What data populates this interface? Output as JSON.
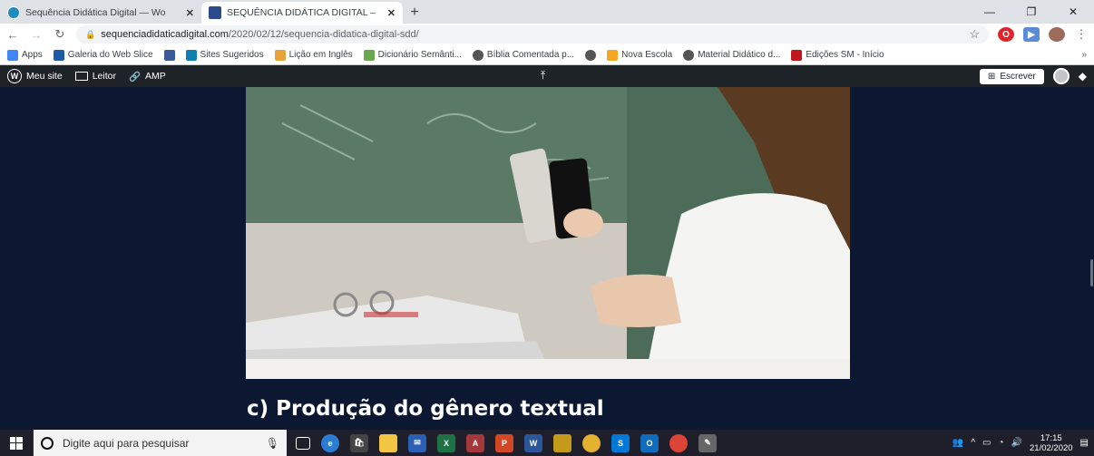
{
  "browser": {
    "tabs": [
      {
        "title": "Sequência Didática Digital — Wo",
        "icon": "wordpress-icon",
        "color": "#1e8cbe",
        "active": false
      },
      {
        "title": "SEQUÊNCIA DIDÁTICA DIGITAL –",
        "icon": "site-favicon",
        "color": "#2b4a8b",
        "active": true
      }
    ],
    "new_tab": "+",
    "window_controls": {
      "minimize": "—",
      "restore": "❐",
      "close": "✕"
    },
    "url_host": "sequenciadidaticadigital.com",
    "url_path": "/2020/02/12/sequencia-didatica-digital-sdd/",
    "bookmarks": [
      {
        "label": "Apps",
        "icon": "apps-grid-icon",
        "color": "#4285f4"
      },
      {
        "label": "Galeria do Web Slice",
        "icon": "web-slice-icon",
        "color": "#1e5aa8"
      },
      {
        "label": "",
        "icon": "facebook-icon",
        "color": "#3b5998"
      },
      {
        "label": "Sites Sugeridos",
        "icon": "bing-icon",
        "color": "#0f7fb2"
      },
      {
        "label": "Lição em Inglês",
        "icon": "lesson-icon",
        "color": "#e8a23a"
      },
      {
        "label": "Dicionário Semânti...",
        "icon": "dictionary-icon",
        "color": "#6aa84f"
      },
      {
        "label": "Bíblia Comentada p...",
        "icon": "globe-icon",
        "color": "#555555"
      },
      {
        "label": "",
        "icon": "globe-icon",
        "color": "#555555"
      },
      {
        "label": "Nova Escola",
        "icon": "nova-escola-icon",
        "color": "#f5a623"
      },
      {
        "label": "Material Didático d...",
        "icon": "globe-icon",
        "color": "#555555"
      },
      {
        "label": "Edições SM - Início",
        "icon": "sm-icon",
        "color": "#c0161f"
      }
    ],
    "bookmarks_more": "»"
  },
  "wp_admin_bar": {
    "my_site": "Meu site",
    "reader": "Leitor",
    "amp": "AMP",
    "write": "Escrever"
  },
  "post": {
    "image_alt": "girl using smartphone in classroom",
    "heading": "c) Produção do gênero textual"
  },
  "taskbar": {
    "search_placeholder": "Digite aqui para pesquisar",
    "time": "17:15",
    "date": "21/02/2020"
  }
}
